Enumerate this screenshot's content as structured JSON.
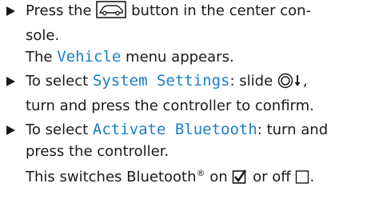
{
  "steps": [
    {
      "a": "Press the",
      "b": "button in the center con-",
      "c": "sole.",
      "result_a": "The",
      "result_term": "Vehicle",
      "result_b": "menu appears."
    },
    {
      "a": "To select",
      "term": "System Settings",
      "b": ": slide",
      "c": ",",
      "d": "turn and press the controller to confirm."
    },
    {
      "a": "To select",
      "term": "Activate Bluetooth",
      "b": ": turn and",
      "c": "press the controller.",
      "note_a": "This switches Bluetooth",
      "note_reg": "®",
      "note_b": "on",
      "note_c": "or off",
      "note_d": "."
    }
  ],
  "colors": {
    "term": "#1a7fc4",
    "text": "#1a1a1a"
  },
  "icons": [
    "car-button-icon",
    "controller-slide-down-icon",
    "checkbox-checked-icon",
    "checkbox-empty-icon"
  ]
}
